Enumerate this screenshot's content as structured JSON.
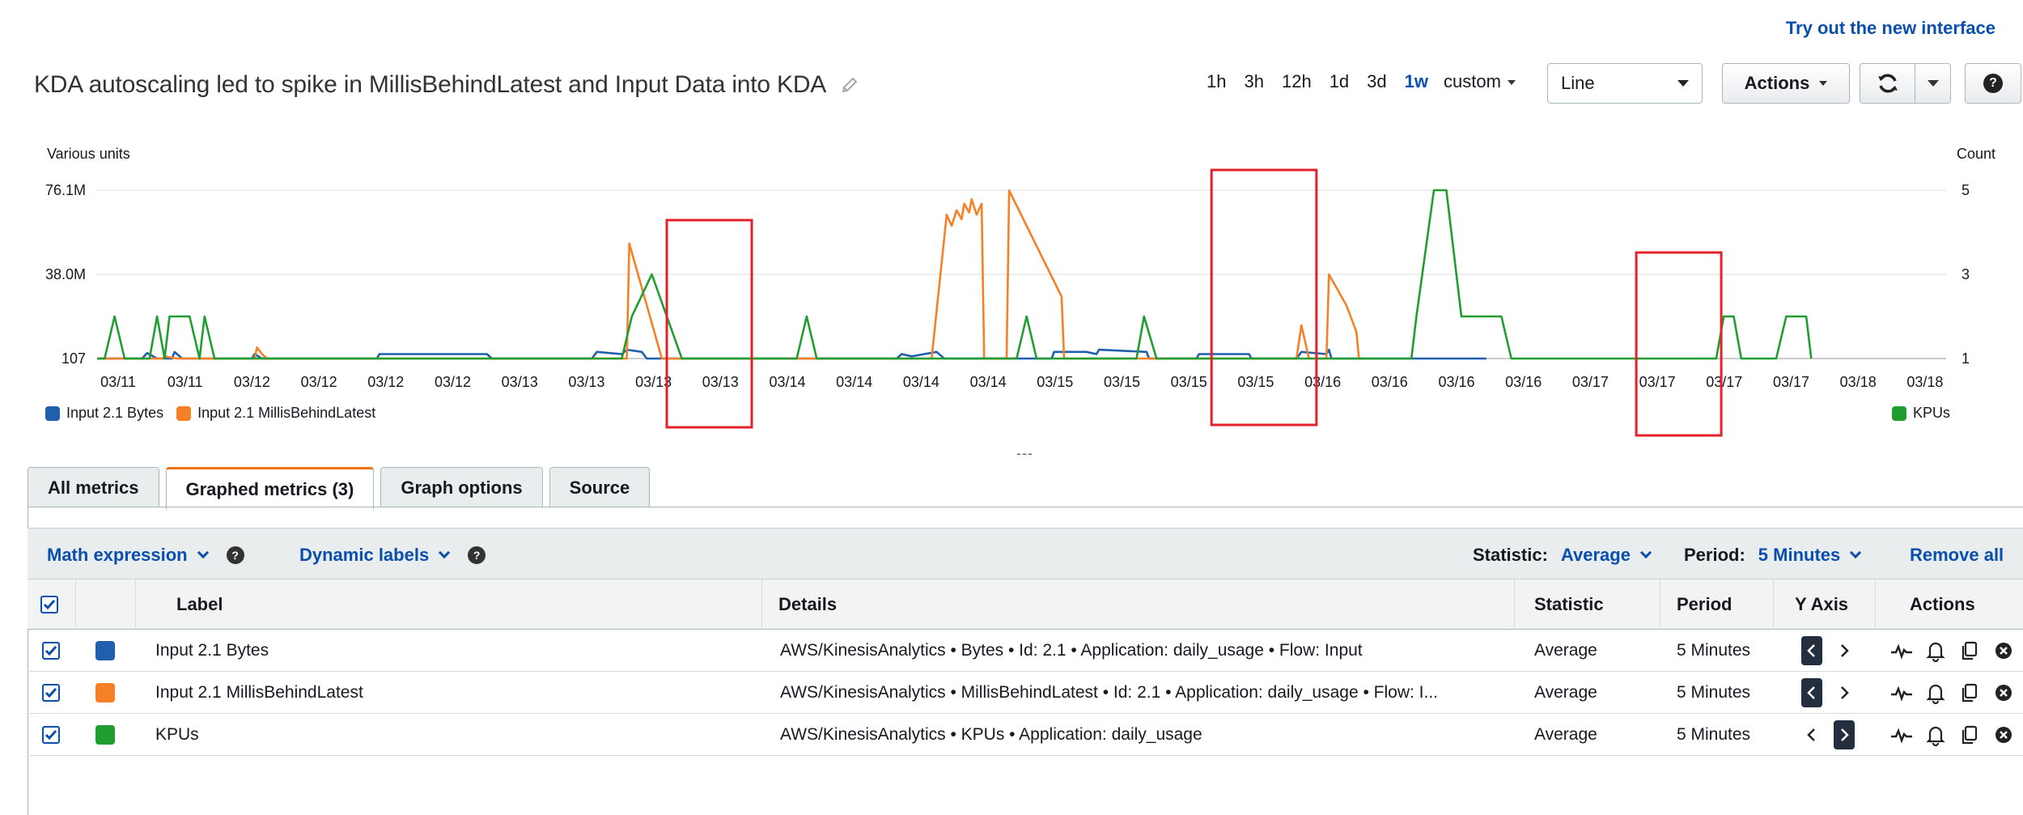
{
  "header": {
    "try_new": "Try out the new interface",
    "title": "KDA autoscaling led to spike in MillisBehindLatest and Input Data into KDA",
    "time_ranges": [
      "1h",
      "3h",
      "12h",
      "1d",
      "3d",
      "1w"
    ],
    "active_range": "1w",
    "custom_label": "custom",
    "chart_type": "Line",
    "actions_label": "Actions"
  },
  "icons": [
    "pencil-icon",
    "refresh-icon",
    "chevron-down-icon",
    "help-icon",
    "graph-icon",
    "bell-icon",
    "copy-icon",
    "close-icon"
  ],
  "chart_data": {
    "type": "line",
    "ylabel_left": "Various units",
    "ylabel_right": "Count",
    "left_ticks": [
      "76.1M",
      "38.0M",
      "107"
    ],
    "right_ticks": [
      "5",
      "3",
      "1"
    ],
    "x_ticks": [
      "03/11",
      "03/11",
      "03/12",
      "03/12",
      "03/12",
      "03/12",
      "03/13",
      "03/13",
      "03/13",
      "03/13",
      "03/14",
      "03/14",
      "03/14",
      "03/14",
      "03/15",
      "03/15",
      "03/15",
      "03/15",
      "03/16",
      "03/16",
      "03/16",
      "03/16",
      "03/17",
      "03/17",
      "03/17",
      "03/17",
      "03/18",
      "03/18"
    ],
    "x_range": [
      0,
      28
    ],
    "left_range": [
      0,
      76.1
    ],
    "right_range": [
      1,
      5
    ],
    "series": [
      {
        "name": "Input 2.1 Bytes",
        "color": "#1f5fae",
        "axis": "left",
        "points": [
          [
            0,
            0
          ],
          [
            0.9,
            0
          ],
          [
            1.0,
            2.5
          ],
          [
            1.2,
            0
          ],
          [
            1.5,
            0
          ],
          [
            1.55,
            3
          ],
          [
            1.7,
            0
          ],
          [
            3.1,
            0
          ],
          [
            3.15,
            2
          ],
          [
            3.3,
            0
          ],
          [
            5.6,
            0
          ],
          [
            5.65,
            2
          ],
          [
            7.8,
            2
          ],
          [
            7.9,
            0
          ],
          [
            9.9,
            0
          ],
          [
            10,
            3
          ],
          [
            10.5,
            2
          ],
          [
            10.6,
            4
          ],
          [
            10.9,
            3
          ],
          [
            11.0,
            0
          ],
          [
            16.0,
            0
          ],
          [
            16.1,
            2
          ],
          [
            16.3,
            1
          ],
          [
            16.8,
            3
          ],
          [
            16.95,
            0
          ],
          [
            19.1,
            0
          ],
          [
            19.15,
            3
          ],
          [
            19.8,
            3
          ],
          [
            20.0,
            2
          ],
          [
            20.05,
            4
          ],
          [
            21.0,
            3
          ],
          [
            21.05,
            0
          ],
          [
            22.0,
            0
          ],
          [
            22.05,
            2
          ],
          [
            23.05,
            2
          ],
          [
            23.1,
            0
          ],
          [
            24.0,
            0
          ],
          [
            24.1,
            3
          ],
          [
            24.6,
            2
          ],
          [
            24.65,
            4
          ],
          [
            24.7,
            0
          ],
          [
            27.8,
            0
          ]
        ]
      },
      {
        "name": "Input 2.1 MillisBehindLatest",
        "color": "#f58025",
        "axis": "left",
        "points": [
          [
            0,
            0
          ],
          [
            1.3,
            0
          ],
          [
            1.35,
            1
          ],
          [
            1.6,
            0
          ],
          [
            3.15,
            0
          ],
          [
            3.2,
            5
          ],
          [
            3.3,
            2
          ],
          [
            3.4,
            0
          ],
          [
            10.6,
            0
          ],
          [
            10.65,
            52
          ],
          [
            11.3,
            0
          ],
          [
            16.7,
            0
          ],
          [
            17.0,
            65
          ],
          [
            17.1,
            60
          ],
          [
            17.2,
            67
          ],
          [
            17.3,
            63
          ],
          [
            17.35,
            70
          ],
          [
            17.45,
            66
          ],
          [
            17.5,
            72
          ],
          [
            17.6,
            65
          ],
          [
            17.7,
            70
          ],
          [
            17.75,
            0
          ],
          [
            18.2,
            0
          ],
          [
            18.25,
            76
          ],
          [
            19.3,
            28
          ],
          [
            19.35,
            0
          ],
          [
            24.0,
            0
          ],
          [
            24.1,
            15
          ],
          [
            24.25,
            0
          ],
          [
            24.6,
            0
          ],
          [
            24.65,
            38
          ],
          [
            25.0,
            24
          ],
          [
            25.2,
            12
          ],
          [
            25.25,
            0
          ]
        ]
      },
      {
        "name": "KPUs",
        "color": "#1f9e2f",
        "axis": "right",
        "points": [
          [
            0,
            1
          ],
          [
            0.15,
            1
          ],
          [
            0.35,
            2
          ],
          [
            0.55,
            1
          ],
          [
            1.05,
            1
          ],
          [
            1.2,
            2
          ],
          [
            1.35,
            1
          ],
          [
            1.45,
            2
          ],
          [
            1.85,
            2
          ],
          [
            2.05,
            1
          ],
          [
            2.15,
            2
          ],
          [
            2.35,
            1
          ],
          [
            10.5,
            1
          ],
          [
            10.7,
            2
          ],
          [
            11.1,
            3
          ],
          [
            11.7,
            1
          ],
          [
            14.0,
            1
          ],
          [
            14.2,
            2
          ],
          [
            14.4,
            1
          ],
          [
            18.4,
            1
          ],
          [
            18.6,
            2
          ],
          [
            18.8,
            1
          ],
          [
            20.8,
            1
          ],
          [
            20.95,
            2
          ],
          [
            21.2,
            1
          ],
          [
            26.3,
            1
          ],
          [
            26.4,
            2
          ],
          [
            26.75,
            5
          ],
          [
            27.0,
            5
          ],
          [
            27.1,
            4
          ],
          [
            27.3,
            2
          ],
          [
            28.1,
            2
          ],
          [
            28.3,
            1
          ],
          [
            32.4,
            1
          ],
          [
            32.55,
            2
          ],
          [
            32.75,
            2
          ],
          [
            32.9,
            1
          ],
          [
            33.6,
            1
          ],
          [
            33.8,
            2
          ],
          [
            34.2,
            2
          ],
          [
            34.3,
            1
          ]
        ]
      }
    ],
    "highlight_boxes": [
      {
        "x_from": 11.4,
        "x_to": 13.1,
        "label": ""
      },
      {
        "x_from": 22.3,
        "x_to": 24.4,
        "label": ""
      },
      {
        "x_from": 30.8,
        "x_to": 32.5,
        "label": ""
      }
    ]
  },
  "legend": {
    "left": [
      {
        "label": "Input 2.1 Bytes",
        "color": "#1f5fae"
      },
      {
        "label": "Input 2.1 MillisBehindLatest",
        "color": "#f58025"
      }
    ],
    "right": [
      {
        "label": "KPUs",
        "color": "#1f9e2f"
      }
    ]
  },
  "resize_handle": "---",
  "tabs": [
    {
      "label": "All metrics",
      "active": false
    },
    {
      "label": "Graphed metrics (3)",
      "active": true
    },
    {
      "label": "Graph options",
      "active": false
    },
    {
      "label": "Source",
      "active": false
    }
  ],
  "toolbar": {
    "math_expression": "Math expression",
    "dynamic_labels": "Dynamic labels",
    "statistic_label": "Statistic:",
    "statistic_value": "Average",
    "period_label": "Period:",
    "period_value": "5 Minutes",
    "remove_all": "Remove all"
  },
  "table": {
    "headers": {
      "label": "Label",
      "details": "Details",
      "statistic": "Statistic",
      "period": "Period",
      "yaxis": "Y Axis",
      "actions": "Actions"
    },
    "rows": [
      {
        "color": "#1f5fae",
        "label": "Input 2.1 Bytes",
        "details": "AWS/KinesisAnalytics • Bytes • Id: 2.1 • Application: daily_usage • Flow: Input",
        "statistic": "Average",
        "period": "5 Minutes",
        "yaxis": "left"
      },
      {
        "color": "#f58025",
        "label": "Input 2.1 MillisBehindLatest",
        "details": "AWS/KinesisAnalytics • MillisBehindLatest • Id: 2.1 • Application: daily_usage • Flow: I...",
        "statistic": "Average",
        "period": "5 Minutes",
        "yaxis": "left"
      },
      {
        "color": "#1f9e2f",
        "label": "KPUs",
        "details": "AWS/KinesisAnalytics • KPUs • Application: daily_usage",
        "statistic": "Average",
        "period": "5 Minutes",
        "yaxis": "right"
      }
    ]
  }
}
